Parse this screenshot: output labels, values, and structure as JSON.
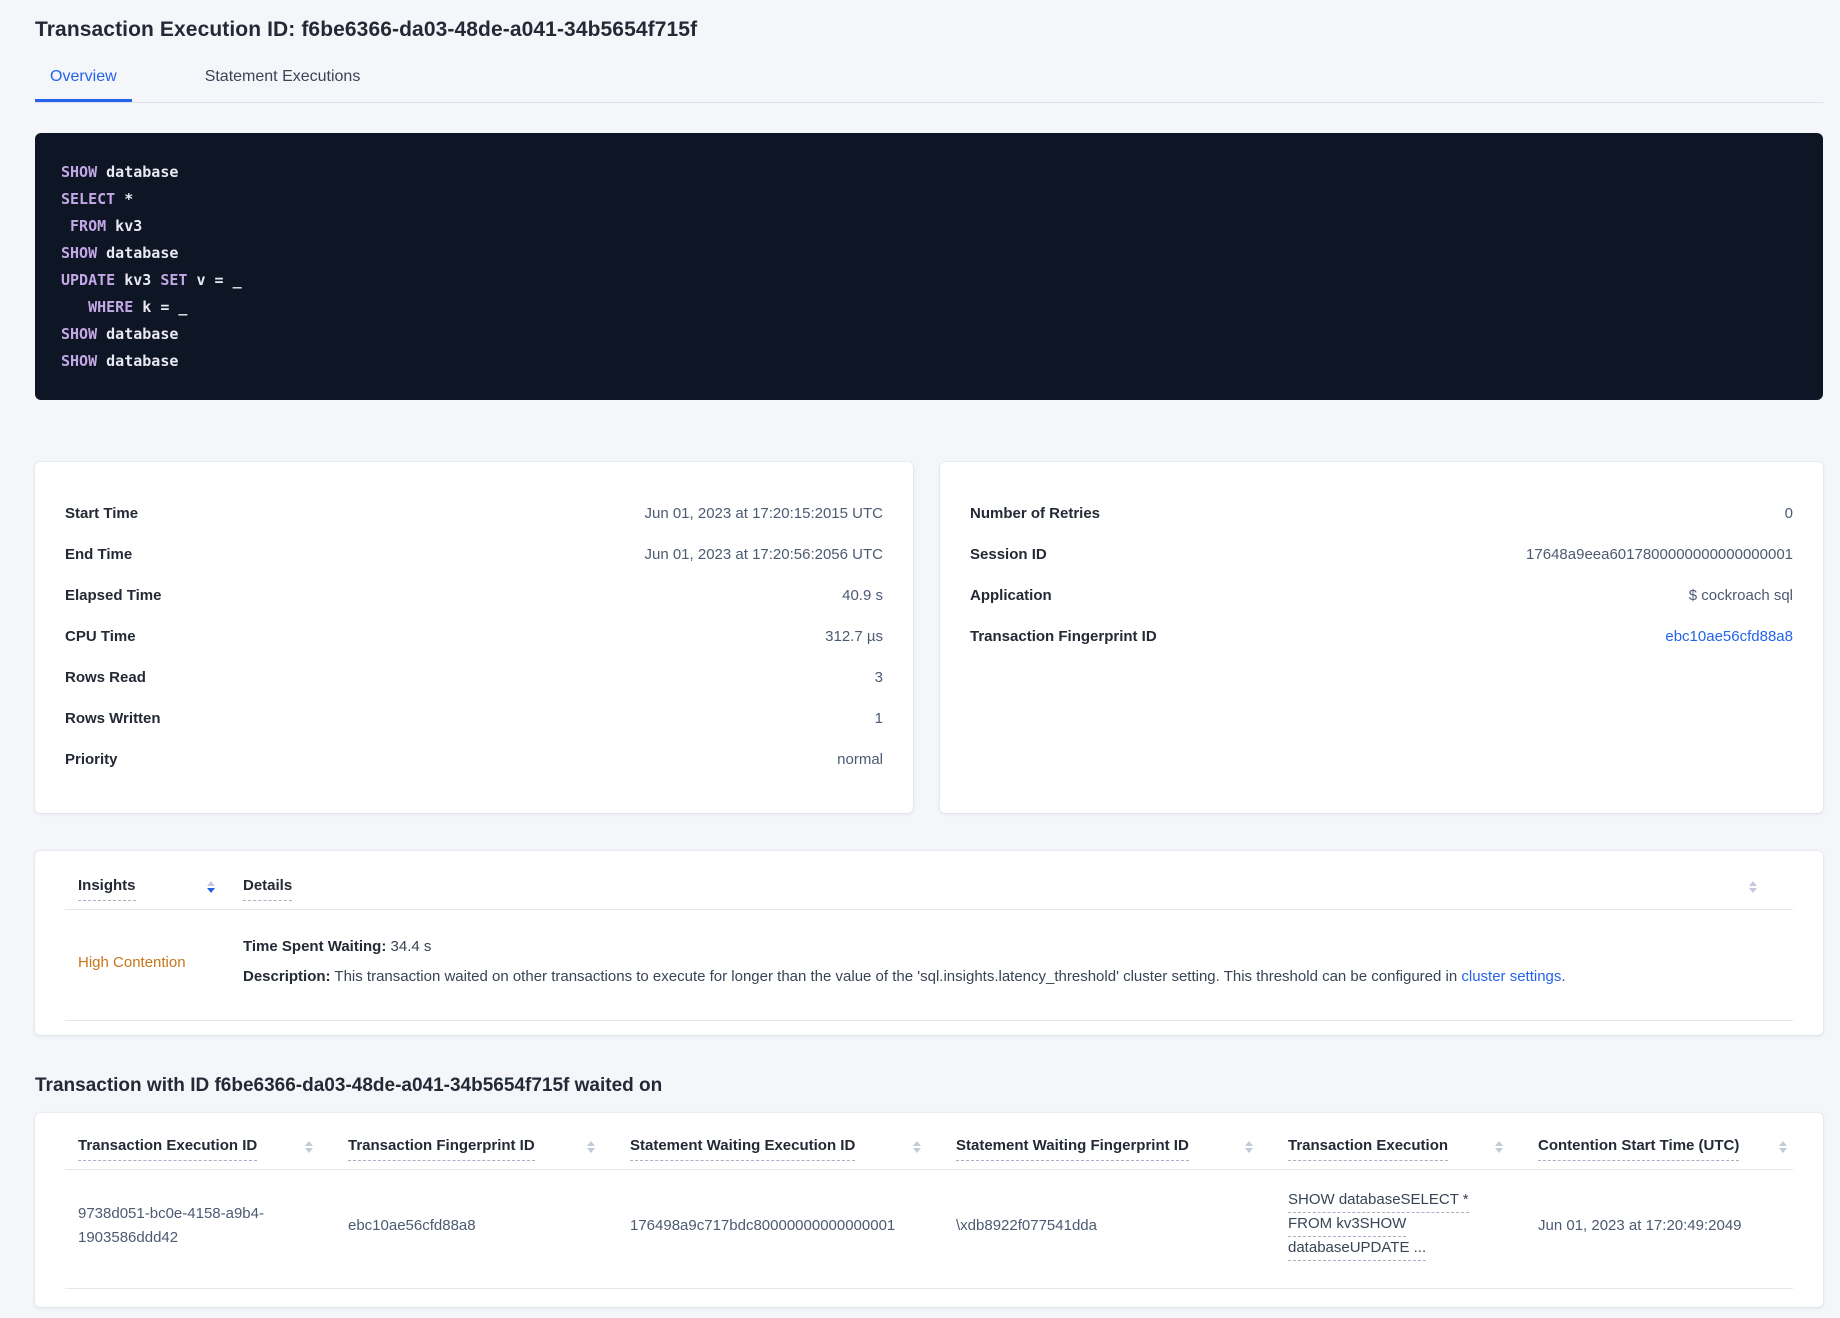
{
  "header": {
    "title": "Transaction Execution ID: f6be6366-da03-48de-a041-34b5654f715f"
  },
  "tabs": {
    "overview": "Overview",
    "statement_executions": "Statement Executions"
  },
  "sql": {
    "lines": [
      {
        "segs": [
          {
            "t": "SHOW"
          },
          {
            "t": " database"
          }
        ]
      },
      {
        "segs": [
          {
            "t": "SELECT"
          },
          {
            "t": " *"
          }
        ]
      },
      {
        "segs": [
          {
            "t": " "
          },
          {
            "t": "FROM"
          },
          {
            "t": " kv3"
          }
        ]
      },
      {
        "segs": [
          {
            "t": "SHOW"
          },
          {
            "t": " database"
          }
        ]
      },
      {
        "segs": [
          {
            "t": "UPDATE"
          },
          {
            "t": " kv3 "
          },
          {
            "t": "SET"
          },
          {
            "t": " v = _"
          }
        ]
      },
      {
        "segs": [
          {
            "t": "   "
          },
          {
            "t": "WHERE"
          },
          {
            "t": " k = _"
          }
        ]
      },
      {
        "segs": [
          {
            "t": "SHOW"
          },
          {
            "t": " database"
          }
        ]
      },
      {
        "segs": [
          {
            "t": "SHOW"
          },
          {
            "t": " database"
          }
        ]
      }
    ]
  },
  "summary_left": {
    "rows": [
      {
        "label": "Start Time",
        "value": "Jun 01, 2023 at 17:20:15:2015 UTC"
      },
      {
        "label": "End Time",
        "value": "Jun 01, 2023 at 17:20:56:2056 UTC"
      },
      {
        "label": "Elapsed Time",
        "value": "40.9 s"
      },
      {
        "label": "CPU Time",
        "value": "312.7 µs"
      },
      {
        "label": "Rows Read",
        "value": "3"
      },
      {
        "label": "Rows Written",
        "value": "1"
      },
      {
        "label": "Priority",
        "value": "normal"
      }
    ]
  },
  "summary_right": {
    "rows": [
      {
        "label": "Number of Retries",
        "value": "0"
      },
      {
        "label": "Session ID",
        "value": "17648a9eea6017800000000000000001"
      },
      {
        "label": "Application",
        "value": "$ cockroach sql"
      },
      {
        "label": "Transaction Fingerprint ID",
        "value": "ebc10ae56cfd88a8"
      }
    ]
  },
  "insights": {
    "columns": {
      "insights": "Insights",
      "details": "Details"
    },
    "row": {
      "insight": "High Contention",
      "waiting_label": "Time Spent Waiting:",
      "waiting_value": " 34.4 s",
      "description_label": "Description:",
      "description_text": " This transaction waited on other transactions to execute for longer than the value of the 'sql.insights.latency_threshold' cluster setting. This threshold can be configured in ",
      "description_link": "cluster settings",
      "description_suffix": "."
    }
  },
  "waited_on": {
    "heading": "Transaction with ID f6be6366-da03-48de-a041-34b5654f715f waited on",
    "columns": [
      "Transaction Execution ID",
      "Transaction Fingerprint ID",
      "Statement Waiting Execution ID",
      "Statement Waiting Fingerprint ID",
      "Transaction Execution",
      "Contention Start Time (UTC)"
    ],
    "row": {
      "transaction_execution_id": "9738d051-bc0e-4158-a9b4-1903586ddd42",
      "transaction_fingerprint_id": "ebc10ae56cfd88a8",
      "statement_waiting_execution_id": "176498a9c717bdc80000000000000001",
      "statement_waiting_fingerprint_id": "\\xdb8922f077541dda",
      "transaction_execution_lines": [
        "SHOW databaseSELECT *",
        "FROM kv3SHOW",
        "databaseUPDATE ..."
      ],
      "contention_start_time": "Jun 01, 2023 at 17:20:49:2049"
    }
  },
  "colors": {
    "accent_blue": "#2563eb",
    "warning_orange": "#c7761a",
    "code_background": "#0e1524",
    "code_keyword": "#c2a8e4",
    "page_background": "#f4f6fa"
  }
}
